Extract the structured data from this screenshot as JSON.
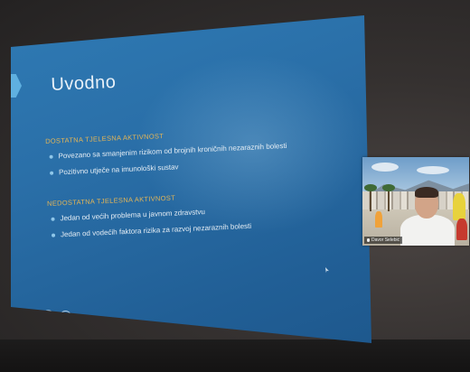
{
  "slide": {
    "title": "Uvodno",
    "sections": [
      {
        "heading": "DOSTATNA TJELESNA AKTIVNOST",
        "bullets": [
          "Povezano sa smanjenim rizikom od brojnih kroničnih nezaraznih bolesti",
          "Pozitivno utječe na imunološki sustav"
        ]
      },
      {
        "heading": "NEDOSTATNA TJELESNA AKTIVNOST",
        "bullets": [
          "Jedan od većih problema u javnom zdravstvu",
          "Jedan od vodećih faktora rizika za razvoj nezaraznih bolesti"
        ]
      }
    ],
    "toolbar_icons": [
      "pen-icon",
      "zoom-icon",
      "more-icon",
      "pointer-icon"
    ],
    "toolbar_glyphs": [
      "✎",
      "⊕",
      "⋯",
      "◎"
    ],
    "accent_color": "#e3b557",
    "background_color": "#2a6fa8"
  },
  "video": {
    "participant_name": "Davor Selebić"
  }
}
